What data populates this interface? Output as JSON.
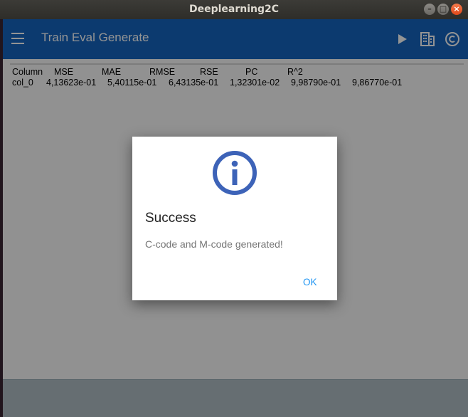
{
  "window": {
    "title": "Deeplearning2C",
    "controls": [
      "–",
      "□",
      "×"
    ]
  },
  "appbar": {
    "title": "Train Eval Generate",
    "icons": [
      "menu-icon",
      "play-icon",
      "building-icon",
      "copyright-icon"
    ]
  },
  "metrics": {
    "header": [
      "Column",
      "MSE",
      "MAE",
      "RMSE",
      "RSE",
      "PC",
      "R^2"
    ],
    "row": [
      "col_0",
      "4,13623e-01",
      "5,40115e-01",
      "6,43135e-01",
      "1,32301e-02",
      "9,98790e-01",
      "9,86770e-01"
    ]
  },
  "dialog": {
    "title": "Success",
    "message": "C-code and M-code generated!",
    "ok_label": "OK",
    "icon": "info-icon"
  },
  "colors": {
    "appbar": "#1565c0",
    "info_icon": "#3d63b8",
    "ok": "#2196f3"
  }
}
